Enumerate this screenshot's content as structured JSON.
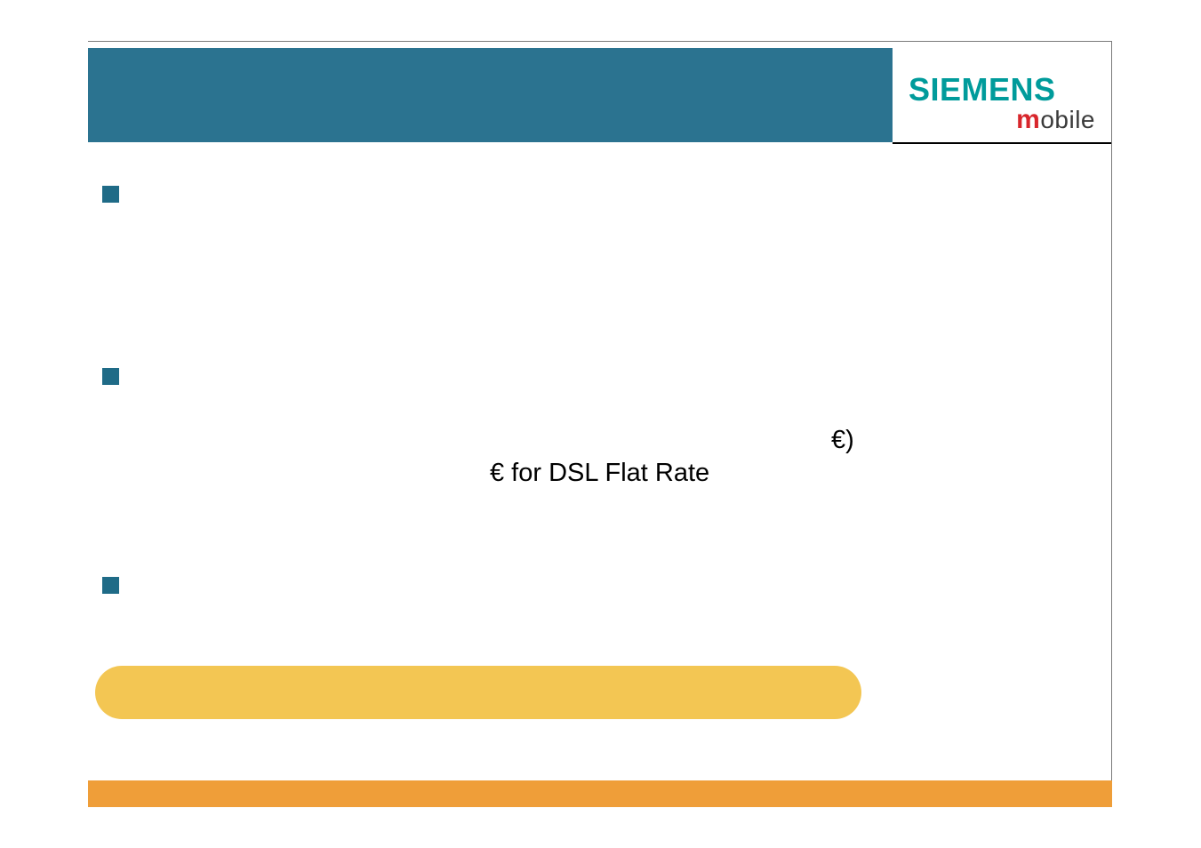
{
  "logo": {
    "brand": "SIEMENS",
    "sub_m": "m",
    "sub_rest": "obile"
  },
  "body": {
    "euro_paren": "€)",
    "euro_dsl": "€ for DSL Flat Rate"
  }
}
